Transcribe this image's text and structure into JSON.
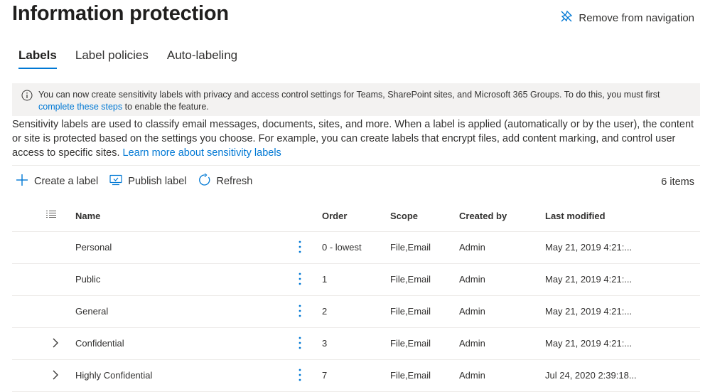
{
  "page": {
    "title": "Information protection",
    "remove_nav_label": "Remove from navigation"
  },
  "tabs": [
    {
      "label": "Labels",
      "active": true
    },
    {
      "label": "Label policies",
      "active": false
    },
    {
      "label": "Auto-labeling",
      "active": false
    }
  ],
  "banner": {
    "text": "You can now create sensitivity labels with privacy and access control settings for Teams, SharePoint sites, and Microsoft 365 Groups. To do this, you must first",
    "link": "complete these steps",
    "suffix": "to enable the feature."
  },
  "description": {
    "text": "Sensitivity labels are used to classify email messages, documents, sites, and more. When a label is applied (automatically or by the user), the content or site is protected based on the settings you choose. For example, you can create labels that encrypt files, add content marking, and control user access to specific sites.",
    "link": "Learn more about sensitivity labels"
  },
  "toolbar": {
    "create_label": "Create a label",
    "publish_label": "Publish label",
    "refresh": "Refresh",
    "items_count": "6 items"
  },
  "table": {
    "columns": {
      "name": "Name",
      "order": "Order",
      "scope": "Scope",
      "created_by": "Created by",
      "last_modified": "Last modified"
    },
    "rows": [
      {
        "name": "Personal",
        "order": "0 - lowest",
        "scope": "File,Email",
        "created_by": "Admin",
        "last_modified": "May 21, 2019 4:21:...",
        "expandable": false
      },
      {
        "name": "Public",
        "order": "1",
        "scope": "File,Email",
        "created_by": "Admin",
        "last_modified": "May 21, 2019 4:21:...",
        "expandable": false
      },
      {
        "name": "General",
        "order": "2",
        "scope": "File,Email",
        "created_by": "Admin",
        "last_modified": "May 21, 2019 4:21:...",
        "expandable": false
      },
      {
        "name": "Confidential",
        "order": "3",
        "scope": "File,Email",
        "created_by": "Admin",
        "last_modified": "May 21, 2019 4:21:...",
        "expandable": true
      },
      {
        "name": "Highly Confidential",
        "order": "7",
        "scope": "File,Email",
        "created_by": "Admin",
        "last_modified": "Jul 24, 2020 2:39:18...",
        "expandable": true
      }
    ]
  },
  "colors": {
    "accent": "#0078d4",
    "banner_bg": "#f3f2f1",
    "text": "#323130",
    "divider": "#edebe9"
  },
  "icons": [
    "unpin-icon",
    "info-icon",
    "plus-icon",
    "publish-icon",
    "refresh-icon",
    "list-view-icon",
    "chevron-right-icon",
    "more-vertical-icon"
  ]
}
